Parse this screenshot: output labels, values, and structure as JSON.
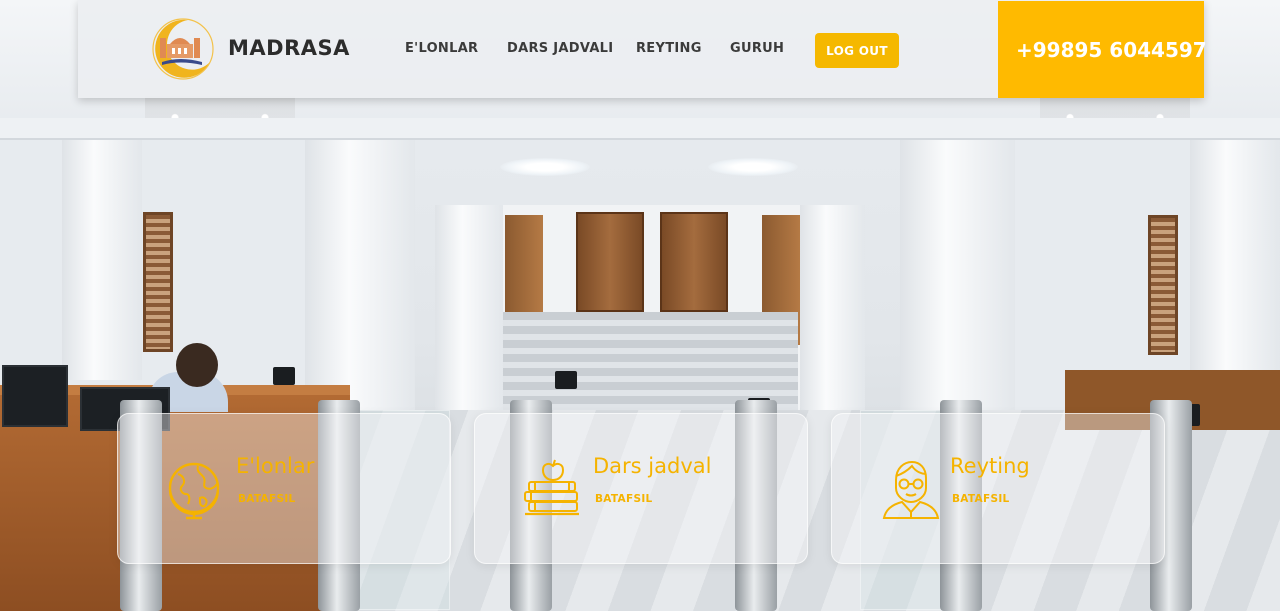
{
  "header": {
    "brand": "MADRASA",
    "logo_caption": "",
    "nav": [
      "E'LONLAR",
      "DARS JADVALI",
      "REYTING",
      "GURUH"
    ],
    "logout_label": "LOG OUT",
    "phone": "+99895 6044597"
  },
  "cards": [
    {
      "title": "E'lonlar",
      "link": "BATAFSIL",
      "icon": "globe-icon"
    },
    {
      "title": "Dars jadval",
      "link": "BATAFSIL",
      "icon": "books-apple-icon"
    },
    {
      "title": "Reyting",
      "link": "BATAFSIL",
      "icon": "teacher-icon"
    }
  ],
  "colors": {
    "accent": "#ffba00",
    "card_text": "#f5b300",
    "nav_text": "#3b3b3b",
    "header_bg": "#eceef1"
  }
}
